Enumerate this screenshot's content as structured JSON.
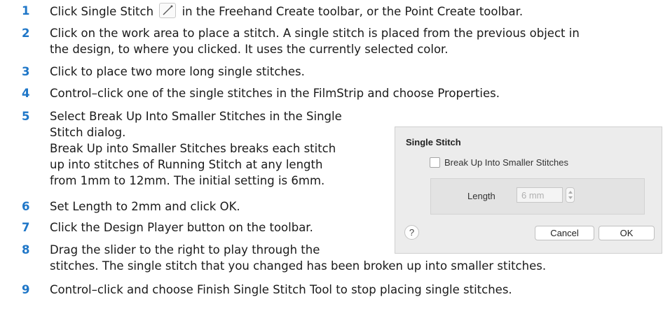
{
  "steps": [
    {
      "num": "1",
      "pre": "Click Single Stitch",
      "post": "in the Freehand Create toolbar, or the Point Create toolbar."
    },
    {
      "num": "2",
      "lines": [
        "Click on the work area to place a stitch. A single stitch is placed from the previous object in",
        "the design, to where you clicked. It uses the currently selected color."
      ]
    },
    {
      "num": "3",
      "text": "Click to place two more long single stitches."
    },
    {
      "num": "4",
      "text": "Control–click one of the single stitches in the FilmStrip and choose Properties."
    },
    {
      "num": "5",
      "lines": [
        "Select Break Up Into Smaller Stitches in the Single",
        "Stitch dialog.",
        "Break Up into Smaller Stitches breaks each stitch",
        "up into stitches of Running Stitch at any length",
        "from 1mm to 12mm. The initial setting is 6mm."
      ]
    },
    {
      "num": "6",
      "text": "Set Length to 2mm and click OK."
    },
    {
      "num": "7",
      "text": "Click the Design Player button on the toolbar."
    },
    {
      "num": "8",
      "lines": [
        "Drag the slider to the right to play through the",
        "stitches. The single stitch that you changed has been broken up into smaller stitches."
      ]
    },
    {
      "num": "9",
      "text": "Control–click and choose Finish Single Stitch Tool to stop placing single stitches."
    }
  ],
  "icon": "single-stitch-icon",
  "dialog": {
    "title": "Single Stitch",
    "checkbox_label": "Break Up Into Smaller Stitches",
    "checkbox_checked": false,
    "length_label": "Length",
    "length_value": "6 mm",
    "help_label": "?",
    "cancel_label": "Cancel",
    "ok_label": "OK"
  },
  "colors": {
    "step_number": "#1f77c8"
  }
}
